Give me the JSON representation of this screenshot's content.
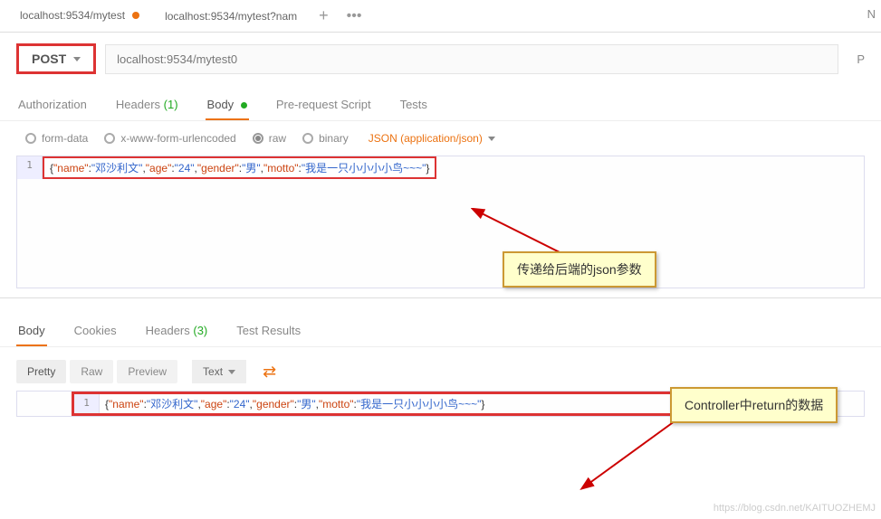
{
  "tabs": {
    "items": [
      {
        "label": "localhost:9534/mytest",
        "modified": true
      },
      {
        "label": "localhost:9534/mytest?nam",
        "modified": false
      }
    ]
  },
  "topRight": "N",
  "request": {
    "method": "POST",
    "url": "localhost:9534/mytest0",
    "rightCut": "P"
  },
  "reqTabs": {
    "auth": "Authorization",
    "headers": "Headers",
    "headersCount": "(1)",
    "body": "Body",
    "prereq": "Pre-request Script",
    "tests": "Tests"
  },
  "bodyTypes": {
    "formData": "form-data",
    "urlencoded": "x-www-form-urlencoded",
    "raw": "raw",
    "binary": "binary",
    "contentType": "JSON (application/json)"
  },
  "reqBody": {
    "lineNo": "1",
    "k1": "\"name\"",
    "v1": "\"邓沙利文\"",
    "k2": "\"age\"",
    "v2": "\"24\"",
    "k3": "\"gender\"",
    "v3": "\"男\"",
    "k4": "\"motto\"",
    "v4": "\"我是一只小小小小鸟~~~\""
  },
  "callout1": "传递给后端的json参数",
  "respTabs": {
    "body": "Body",
    "cookies": "Cookies",
    "headers": "Headers",
    "headersCount": "(3)",
    "testResults": "Test Results"
  },
  "respCtrl": {
    "pretty": "Pretty",
    "raw": "Raw",
    "preview": "Preview",
    "textSel": "Text"
  },
  "respBody": {
    "lineNo": "1",
    "k1": "\"name\"",
    "v1": "\"邓沙利文\"",
    "k2": "\"age\"",
    "v2": "\"24\"",
    "k3": "\"gender\"",
    "v3": "\"男\"",
    "k4": "\"motto\"",
    "v4": "\"我是一只小小小小鸟~~~\""
  },
  "callout2": "Controller中return的数据",
  "watermark": "https://blog.csdn.net/KAITUOZHEMJ"
}
